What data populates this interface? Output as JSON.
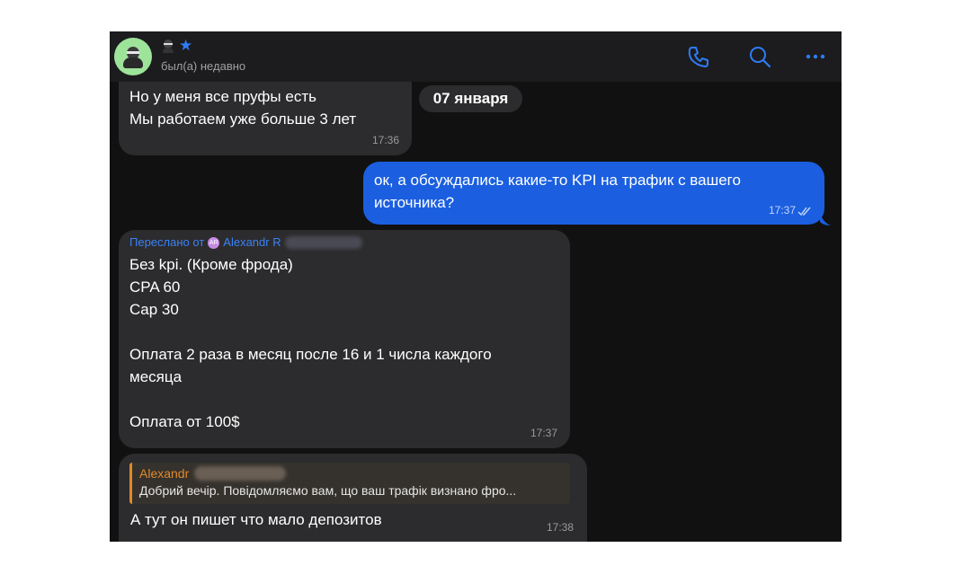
{
  "header": {
    "status": "был(а) недавно",
    "icons": {
      "avatar": "ninja-avatar",
      "star": "star-icon",
      "call": "phone-icon",
      "search": "search-icon",
      "more": "more-icon"
    },
    "accent_color": "#2e7cf6"
  },
  "date_separator": "07 января",
  "messages": [
    {
      "direction": "in",
      "lines": [
        "Но у меня все пруфы есть",
        "Мы работаем уже больше 3 лет"
      ],
      "time": "17:36"
    },
    {
      "direction": "out",
      "lines": [
        "ок, а обсуждались какие-то KPI на трафик с вашего",
        "источника?"
      ],
      "time": "17:37",
      "status_icon": "double-check-icon"
    },
    {
      "direction": "in",
      "forwarded_label": "Переслано от",
      "forwarded_name": "Alexandr R",
      "forwarded_avatar_initials": "AR",
      "lines": [
        "Без kpi. (Кроме фрода)",
        "CPA 60",
        "Cap 30",
        "",
        "Оплата 2 раза в месяц после 16 и 1 числа каждого",
        "месяца",
        "",
        "Оплата от 100$"
      ],
      "time": "17:37"
    },
    {
      "direction": "in",
      "reply_name": "Alexandr",
      "reply_text": "Добрий вечір. Повідомляємо вам, що ваш трафік визнано фро...",
      "text": "А тут он пишет что мало депозитов",
      "time": "17:38"
    }
  ]
}
